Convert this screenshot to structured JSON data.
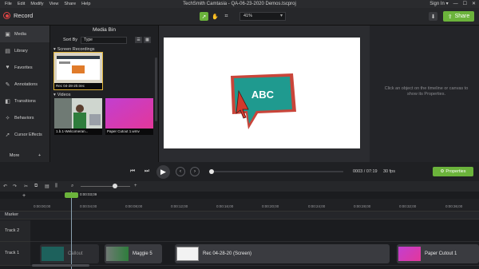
{
  "menu": [
    "File",
    "Edit",
    "Modify",
    "View",
    "Share",
    "Help"
  ],
  "window_title": "TechSmith Camtasia - QA-06-23-2020 Demos.tscproj",
  "signin": "Sign In ▾",
  "record_label": "Record",
  "zoom": "41%",
  "share_label": "Share",
  "sidebar": {
    "items": [
      {
        "label": "Media",
        "icon": "film-icon"
      },
      {
        "label": "Library",
        "icon": "library-icon"
      },
      {
        "label": "Favorites",
        "icon": "heart-icon"
      },
      {
        "label": "Annotations",
        "icon": "annotation-icon"
      },
      {
        "label": "Transitions",
        "icon": "transition-icon"
      },
      {
        "label": "Behaviors",
        "icon": "behavior-icon"
      },
      {
        "label": "Cursor Effects",
        "icon": "cursor-icon"
      }
    ],
    "more": "More"
  },
  "media_bin": {
    "title": "Media Bin",
    "sort_label": "Sort By",
    "sort_value": "Type",
    "sections": {
      "screen_recordings": "Screen Recordings",
      "videos": "Videos"
    },
    "recordings": [
      {
        "caption": "Rec 04-28-20.trec"
      }
    ],
    "videos": [
      {
        "caption": "1.b.1-Welcomeran..."
      },
      {
        "caption": "Paper Cutout 1.wmv"
      }
    ]
  },
  "canvas": {
    "callout_text": "ABC"
  },
  "properties_hint": "Click an object on the timeline or canvas to show its Properties.",
  "playback": {
    "timecode": "0003 / 07:19",
    "fps": "30 fps",
    "properties_button": "Properties"
  },
  "timeline": {
    "playhead_time": "0:00:03;09",
    "ticks": [
      "0:00:00;00",
      "0:00:04;00",
      "0:00:08;00",
      "0:00:12;00",
      "0:00:16;00",
      "0:00:20;00",
      "0:00:24;00",
      "0:00:28;00",
      "0:00:32;00",
      "0:00:36;00"
    ],
    "marker_label": "Marker",
    "tracks": [
      "Track 2",
      "Track 1"
    ],
    "clips": [
      {
        "label": "Callout"
      },
      {
        "label": "Maggie 5"
      },
      {
        "label": "Rec 04-28-20 (Screen)"
      },
      {
        "label": "Paper Cutout 1"
      }
    ]
  },
  "colors": {
    "accent": "#6bb33b",
    "record": "#e04545",
    "callout_fill": "#1f9a8f",
    "callout_border": "#c9453a"
  }
}
